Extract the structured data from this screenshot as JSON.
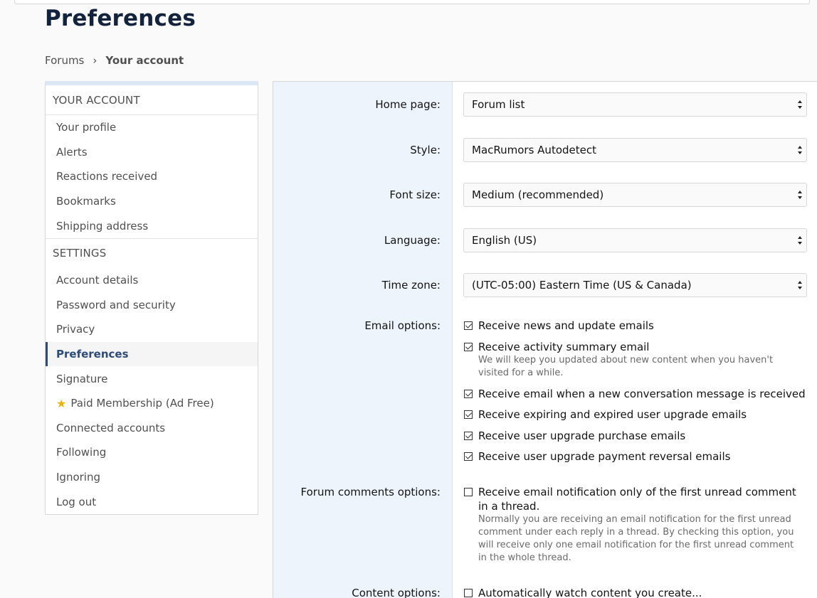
{
  "page": {
    "title": "Preferences"
  },
  "breadcrumb": {
    "items": [
      "Forums",
      "Your account"
    ]
  },
  "sidebar": {
    "account_header": "YOUR ACCOUNT",
    "account_items": [
      "Your profile",
      "Alerts",
      "Reactions received",
      "Bookmarks",
      "Shipping address"
    ],
    "settings_header": "SETTINGS",
    "settings_items": [
      "Account details",
      "Password and security",
      "Privacy",
      "Preferences",
      "Signature",
      "Paid Membership (Ad Free)",
      "Connected accounts",
      "Following",
      "Ignoring",
      "Log out"
    ],
    "active_item": "Preferences"
  },
  "form": {
    "home_page": {
      "label": "Home page:",
      "value": "Forum list"
    },
    "style": {
      "label": "Style:",
      "value": "MacRumors Autodetect"
    },
    "font_size": {
      "label": "Font size:",
      "value": "Medium (recommended)"
    },
    "language": {
      "label": "Language:",
      "value": "English (US)"
    },
    "time_zone": {
      "label": "Time zone:",
      "value": "(UTC-05:00) Eastern Time (US & Canada)"
    },
    "email_options": {
      "label": "Email options:",
      "items": [
        {
          "text": "Receive news and update emails",
          "checked": true,
          "hint": ""
        },
        {
          "text": "Receive activity summary email",
          "checked": true,
          "hint": "We will keep you updated about new content when you haven't visited for a while."
        },
        {
          "text": "Receive email when a new conversation message is received",
          "checked": true,
          "hint": ""
        },
        {
          "text": "Receive expiring and expired user upgrade emails",
          "checked": true,
          "hint": ""
        },
        {
          "text": "Receive user upgrade purchase emails",
          "checked": true,
          "hint": ""
        },
        {
          "text": "Receive user upgrade payment reversal emails",
          "checked": true,
          "hint": ""
        }
      ]
    },
    "forum_comments_options": {
      "label": "Forum comments options:",
      "text": "Receive email notification only of the first unread comment in a thread.",
      "checked": false,
      "hint": "Normally you are receiving an email notification for the first unread comment under each reply in a thread. By checking this option, you will receive only one email notification for the first unread comment in the whole thread."
    },
    "content_options": {
      "label": "Content options:",
      "text": "Automatically watch content you create...",
      "checked": false
    }
  }
}
